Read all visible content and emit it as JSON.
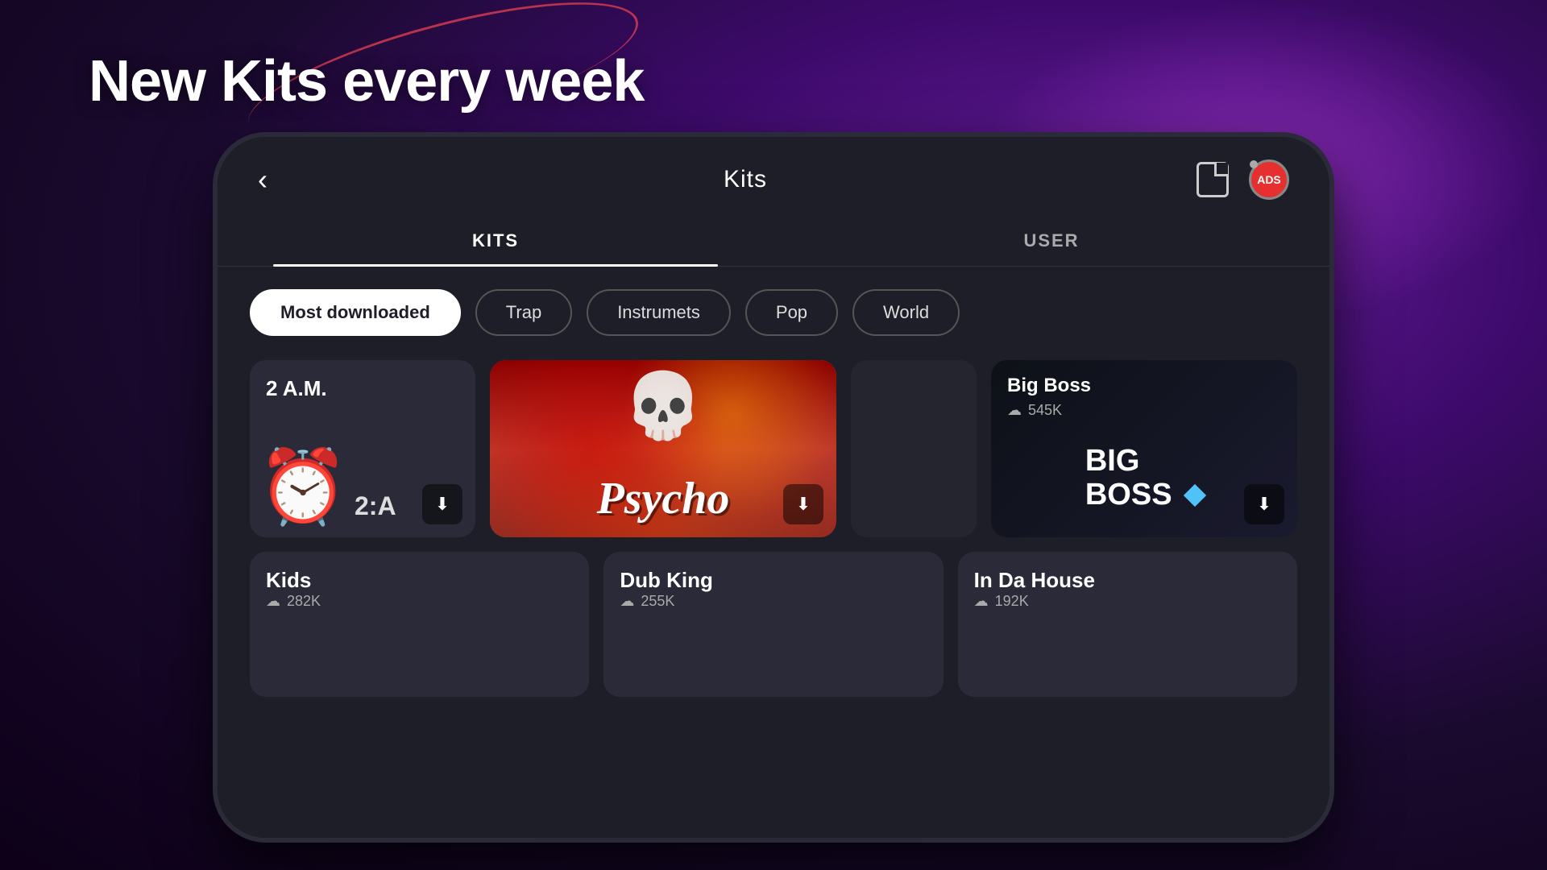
{
  "hero": {
    "title": "New Kits every week"
  },
  "app": {
    "header": {
      "title": "Kits",
      "back_label": "‹",
      "ads_label": "ADS"
    },
    "tabs": [
      {
        "id": "kits",
        "label": "KITS",
        "active": true
      },
      {
        "id": "user",
        "label": "USER",
        "active": false
      }
    ],
    "filters": [
      {
        "id": "most-downloaded",
        "label": "Most downloaded",
        "active": true
      },
      {
        "id": "trap",
        "label": "Trap",
        "active": false
      },
      {
        "id": "instrumets",
        "label": "Instrumets",
        "active": false
      },
      {
        "id": "pop",
        "label": "Pop",
        "active": false
      },
      {
        "id": "world",
        "label": "World",
        "active": false
      }
    ],
    "cards_row1": [
      {
        "id": "2am",
        "title": "2 A.M.",
        "art_label": "2:A",
        "emoji": "🕐"
      },
      {
        "id": "psycho",
        "title": "Psycho",
        "featured": true
      },
      {
        "id": "empty",
        "title": ""
      },
      {
        "id": "bigboss",
        "title": "Big Boss",
        "downloads": "545K",
        "logo_line1": "BIG",
        "logo_line2": "BOSS"
      }
    ],
    "cards_row2": [
      {
        "id": "kids",
        "title": "Kids",
        "downloads": "282K"
      },
      {
        "id": "dubking",
        "title": "Dub King",
        "downloads": "255K"
      },
      {
        "id": "inhouse",
        "title": "In Da House",
        "downloads": "192K"
      }
    ]
  }
}
